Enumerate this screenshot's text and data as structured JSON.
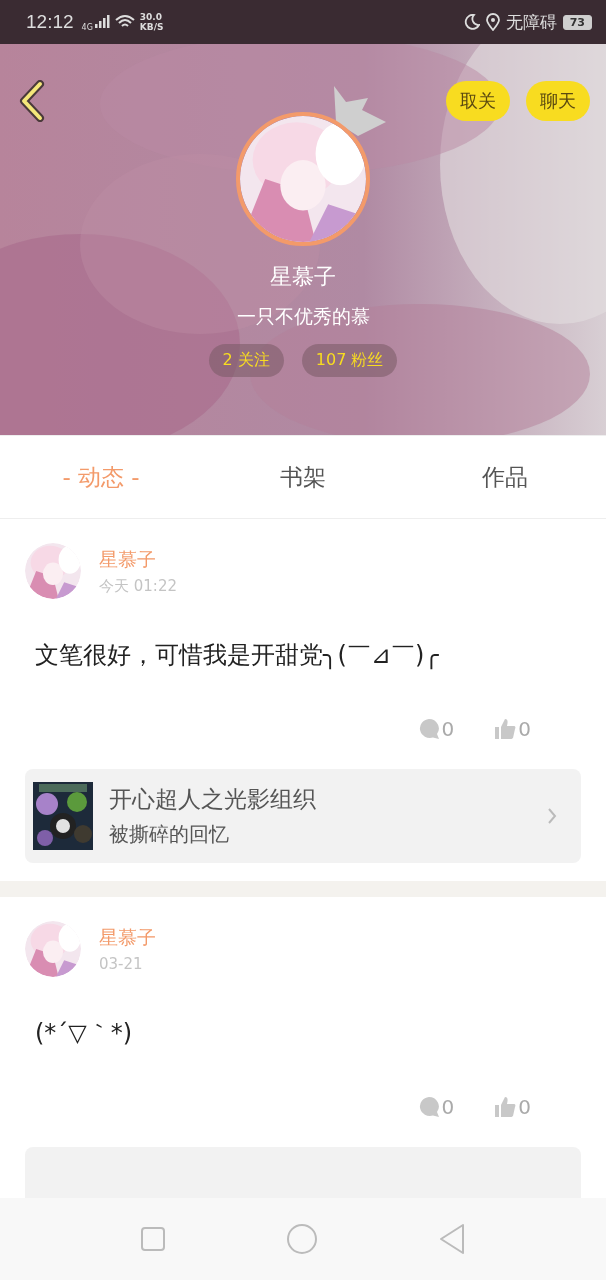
{
  "status_bar": {
    "time": "12:12",
    "network": "4G",
    "speed": "30.0",
    "speed_unit": "KB/S",
    "label": "无障碍",
    "battery": "73"
  },
  "header": {
    "buttons": [
      "取关",
      "聊天"
    ],
    "name": "星慕子",
    "bio": "一只不优秀的慕",
    "stats": [
      "2 关注",
      "107 粉丝"
    ]
  },
  "tabs": [
    {
      "label": "- 动态 -",
      "selected": true
    },
    {
      "label": "书架",
      "selected": false
    },
    {
      "label": "作品",
      "selected": false
    }
  ],
  "posts": [
    {
      "author": "星慕子",
      "time": "今天 01:22",
      "text": "文笔很好，可惜我是开甜党╮(￣⊿￣)╭",
      "comments": "0",
      "likes": "0",
      "attachment": {
        "kind": "book",
        "title": "开心超人之光影组织",
        "subtitle": "被撕碎的回忆"
      }
    },
    {
      "author": "星慕子",
      "time": "03-21",
      "text": "(*´▽｀*)",
      "comments": "0",
      "likes": "0",
      "attachment": {
        "kind": "reply"
      }
    }
  ]
}
